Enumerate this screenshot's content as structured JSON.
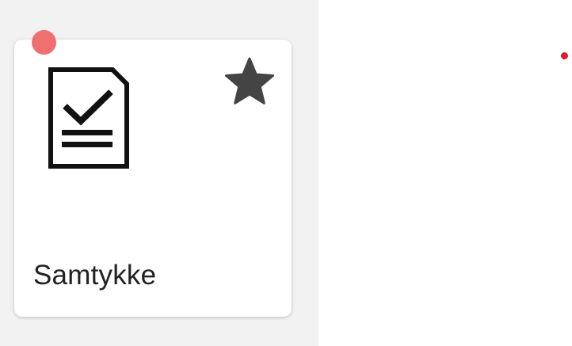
{
  "colors": {
    "panel_background": "#f2f2f2",
    "card_background": "#ffffff",
    "notification_dot": "#f07070",
    "star": "#444444",
    "document_icon": "#111111",
    "indicator_dot": "#e0192a"
  },
  "card": {
    "label": "Samtykke",
    "icon": "document-checkmark-icon",
    "favorite_icon": "star-icon"
  }
}
